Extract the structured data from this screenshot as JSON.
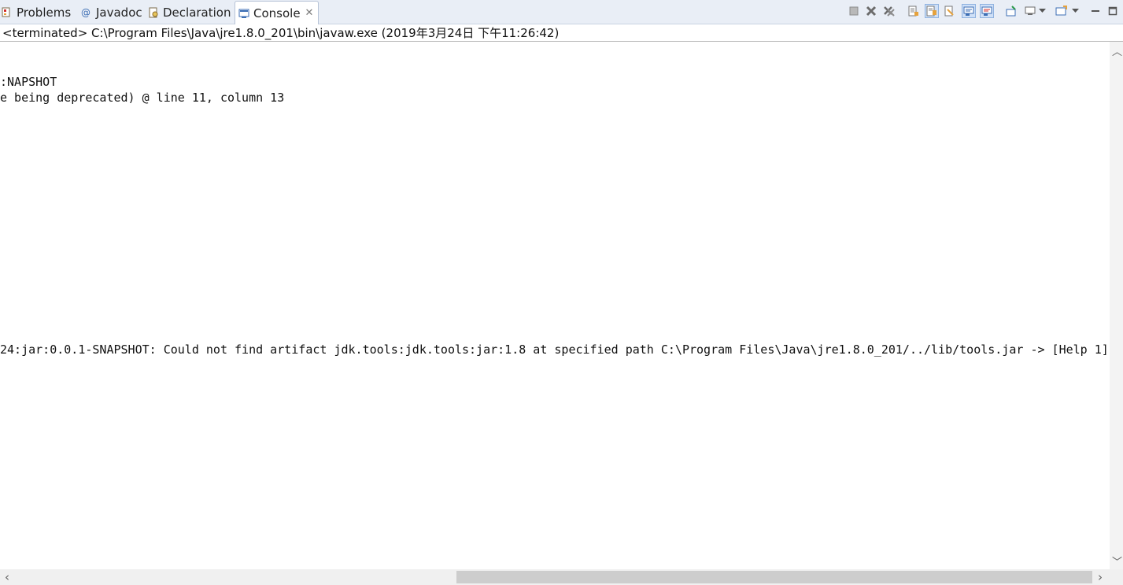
{
  "tabs": [
    {
      "label": "Problems",
      "icon": "problems-icon"
    },
    {
      "label": "Javadoc",
      "icon": "at-icon"
    },
    {
      "label": "Declaration",
      "icon": "declaration-icon"
    },
    {
      "label": "Console",
      "icon": "console-icon",
      "active": true
    }
  ],
  "console": {
    "status": "<terminated> C:\\Program Files\\Java\\jre1.8.0_201\\bin\\javaw.exe (2019年3月24日 下午11:26:42)",
    "lines": [
      ":NAPSHOT",
      "e being deprecated) @ line 11, column 13",
      "24:jar:0.0.1-SNAPSHOT: Could not find artifact jdk.tools:jdk.tools:jar:1.8 at specified path C:\\Program Files\\Java\\jre1.8.0_201/../lib/tools.jar -> [Help 1]"
    ]
  },
  "colors": {
    "tabbar_bg": "#e9eef6",
    "accent": "#3c6eb4",
    "terminate_red": "#d02b2b"
  }
}
